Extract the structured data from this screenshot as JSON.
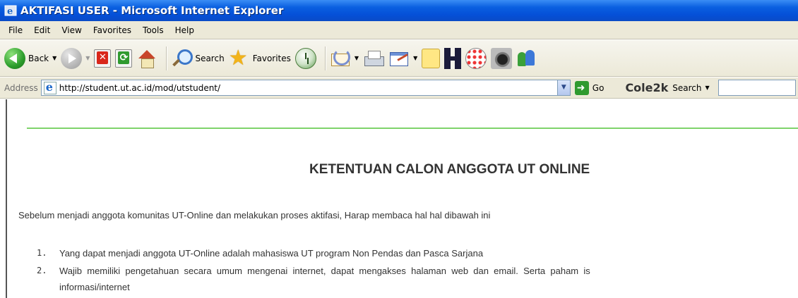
{
  "window": {
    "title": "AKTIFASI USER - Microsoft Internet Explorer"
  },
  "menubar": {
    "items": [
      "File",
      "Edit",
      "View",
      "Favorites",
      "Tools",
      "Help"
    ]
  },
  "toolbar": {
    "back_label": "Back",
    "search_label": "Search",
    "favorites_label": "Favorites",
    "icons": [
      "back-icon",
      "forward-icon",
      "stop-icon",
      "refresh-icon",
      "home-icon",
      "search-icon",
      "favorites-star-icon",
      "history-icon",
      "mail-icon",
      "print-icon",
      "edit-icon",
      "note-icon",
      "h-icon",
      "dots-icon",
      "camera-icon",
      "messenger-icon"
    ]
  },
  "addressbar": {
    "label": "Address",
    "url": "http://student.ut.ac.id/mod/utstudent/",
    "go_label": "Go",
    "brand": "Cole2k",
    "search_label": "Search"
  },
  "page": {
    "heading": "KETENTUAN CALON ANGGOTA UT ONLINE",
    "intro": "Sebelum menjadi anggota komunitas UT-Online dan melakukan proses aktifasi, Harap membaca hal hal dibawah ini",
    "list": [
      {
        "num": "1.",
        "text": "Yang dapat menjadi anggota UT-Online adalah mahasiswa UT program Non Pendas dan Pasca Sarjana"
      },
      {
        "num": "2.",
        "text": "Wajib  memiliki  pengetahuan  secara  umum  mengenai  internet,  dapat  mengakses  halaman  web  dan  email.  Serta  paham  is",
        "continuation": "informasi/internet"
      }
    ]
  },
  "colors": {
    "titlebar_blue": "#0550d8",
    "chrome_beige": "#ece9d8",
    "rule_green": "#7fd36b",
    "text_gray": "#333333"
  }
}
